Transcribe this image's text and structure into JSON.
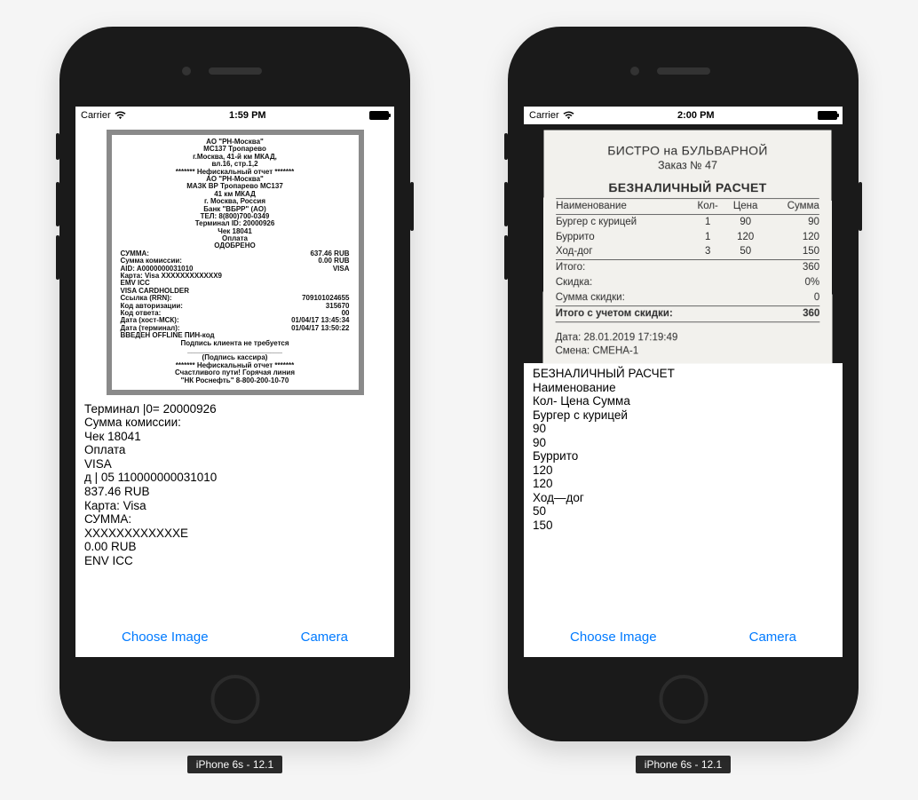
{
  "left": {
    "status": {
      "carrier": "Carrier",
      "time": "1:59 PM"
    },
    "receipt": {
      "header_lines": [
        "АО \"РН-Москва\"",
        "МС137 Тропарево",
        "г.Москва, 41-й км МКАД,",
        "вл.16, стр.1,2",
        "******* Нефискальный отчет *******",
        "АО \"РН-Москва\"",
        "МАЗК ВР Тропарево МС137",
        "41 км МКАД",
        "г. Москва, Россия",
        "Банк \"ВБРР\" (АО)",
        "ТЕЛ: 8(800)700-0349",
        "Терминал ID: 20000926",
        "Чек 18041",
        "Оплата",
        "ОДОБРЕНО"
      ],
      "rows": [
        {
          "l": "СУММА:",
          "r": "637.46 RUB"
        },
        {
          "l": "Сумма комиссии:",
          "r": "0.00 RUB"
        },
        {
          "l": "AID:  A0000000031010",
          "r": "VISA"
        },
        {
          "l": "Карта: Visa   XXXXXXXXXXXX9",
          "r": ""
        },
        {
          "l": "EMV ICC",
          "r": ""
        },
        {
          "l": "   VISA CARDHOLDER",
          "r": ""
        },
        {
          "l": "Ссылка (RRN):",
          "r": "709101024655"
        },
        {
          "l": "Код авторизации:",
          "r": "315670"
        },
        {
          "l": "Код ответа:",
          "r": "00"
        },
        {
          "l": "Дата (хост-МСК):",
          "r": "01/04/17 13:45:34"
        },
        {
          "l": "Дата (терминал):",
          "r": "01/04/17 13:50:22"
        },
        {
          "l": "ВВЕДЕН OFFLINE ПИН-код",
          "r": ""
        }
      ],
      "footer_lines": [
        "Подпись клиента не требуется",
        "________________________",
        "(Подпись кассира)",
        "******* Нефискальный отчет *******",
        "Счастливого пути! Горячая линия",
        "\"НК Роснефть\" 8-800-200-10-70"
      ]
    },
    "ocr_lines": [
      "Терминал |0= 20000926",
      "Сумма комиссии:",
      "Чек 18041",
      "Оплата",
      "VISA",
      "д | 05 110000000031010",
      "837.46 RUB",
      "Карта: Visa",
      "СУММА:",
      "ХХХХХХХХХХХХЕ",
      "0.00 RUB",
      "ENV ICC"
    ],
    "buttons": {
      "choose": "Choose Image",
      "camera": "Camera"
    },
    "device_label": "iPhone 6s - 12.1"
  },
  "right": {
    "status": {
      "carrier": "Carrier",
      "time": "2:00 PM"
    },
    "receipt": {
      "title": "БИСТРО на БУЛЬВАРНОЙ",
      "order": "Заказ № 47",
      "cashless": "БЕЗНАЛИЧНЫЙ РАСЧЕТ",
      "headers": {
        "name": "Наименование",
        "qty": "Кол-",
        "price": "Цена",
        "sum": "Сумма"
      },
      "items": [
        {
          "name": "Бургер с курицей",
          "qty": "1",
          "price": "90",
          "sum": "90"
        },
        {
          "name": "Буррито",
          "qty": "1",
          "price": "120",
          "sum": "120"
        },
        {
          "name": "Ход-дог",
          "qty": "3",
          "price": "50",
          "sum": "150"
        }
      ],
      "totals": {
        "itogo_label": "Итого:",
        "itogo": "360",
        "discount_label": "Скидка:",
        "discount": "0%",
        "discount_sum_label": "Сумма скидки:",
        "discount_sum": "0",
        "final_label": "Итого с учетом скидки:",
        "final": "360"
      },
      "meta": {
        "date_label": "Дата:",
        "date": "28.01.2019 17:19:49",
        "shift_label": "Смена:",
        "shift": "СМЕНА-1"
      }
    },
    "ocr_lines": [
      "БЕЗНАЛИЧНЫЙ РАСЧЕТ",
      "Наименование",
      "Кол- Цена Сумма",
      "Бургер с курицей",
      "90",
      "90",
      "Буррито",
      "120",
      "120",
      "Ход—дог",
      "50",
      "150"
    ],
    "buttons": {
      "choose": "Choose Image",
      "camera": "Camera"
    },
    "device_label": "iPhone 6s - 12.1"
  }
}
